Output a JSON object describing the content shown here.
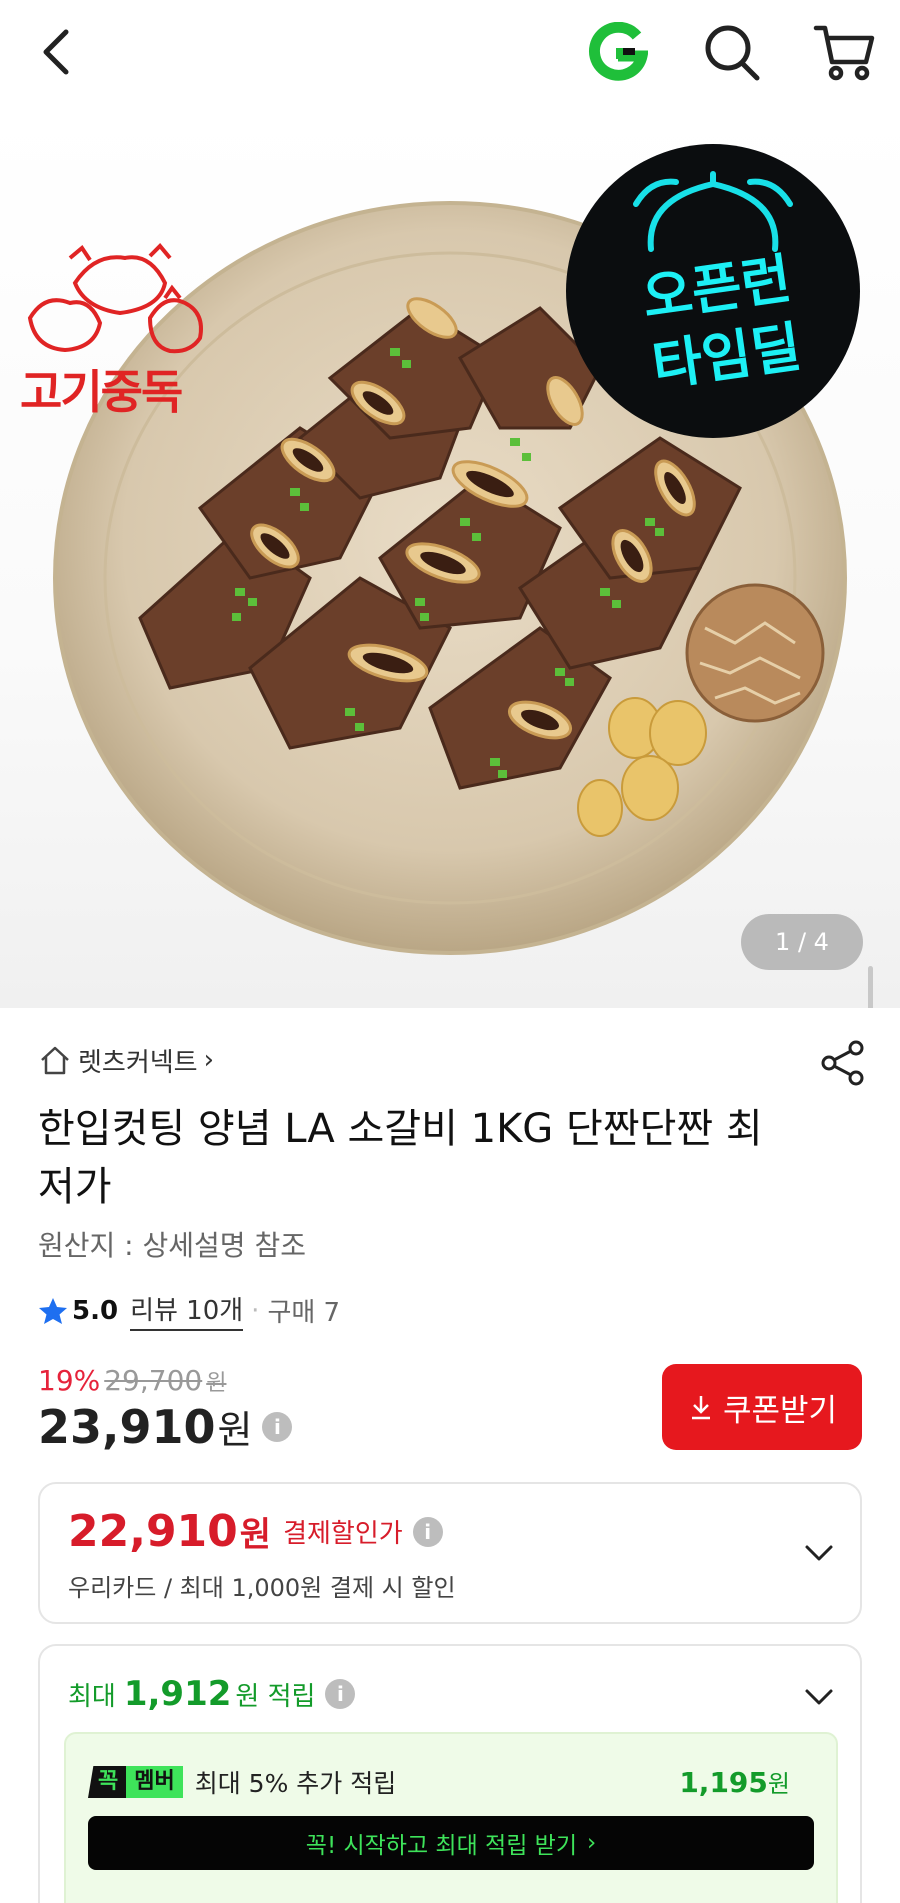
{
  "header": {
    "back_icon": "chevron-left-icon",
    "logo": "G",
    "search_icon": "search-icon",
    "cart_icon": "cart-icon"
  },
  "hero": {
    "brand_logo_text": "고기중독",
    "badge_line1": "오픈런",
    "badge_line2": "타임딜",
    "page_indicator": "1 / 4"
  },
  "product": {
    "shop_name": "렛츠커넥트",
    "shop_chevron": "›",
    "title": "한입컷팅 양념 LA 소갈비 1KG 단짠단짠 최저가",
    "origin": "원산지 : 상세설명 참조",
    "rating": "5.0",
    "review_label": "리뷰 10개",
    "dot": "·",
    "purchase": "구매 7"
  },
  "price": {
    "discount_pct": "19%",
    "original_price": "29,700",
    "original_unit": "원",
    "sale_price": "23,910",
    "sale_unit": "원",
    "coupon_button": "쿠폰받기",
    "accent_color": "#e6181e"
  },
  "card_discount": {
    "price": "22,910",
    "unit": "원",
    "label": "결제할인가",
    "desc": "우리카드 / 최대 1,000원 결제 시 할인"
  },
  "card_points": {
    "prefix": "최대",
    "amount": "1,912",
    "suffix": "원 적립",
    "badge_part1": "꼭",
    "badge_part2": "멤버",
    "member_text": "최대 5% 추가 적립",
    "member_amount": "1,195",
    "member_unit": "원",
    "cta": "꼭! 시작하고 최대 적립 받기",
    "cta_chevron": "›",
    "accent_color": "#139b2a"
  }
}
